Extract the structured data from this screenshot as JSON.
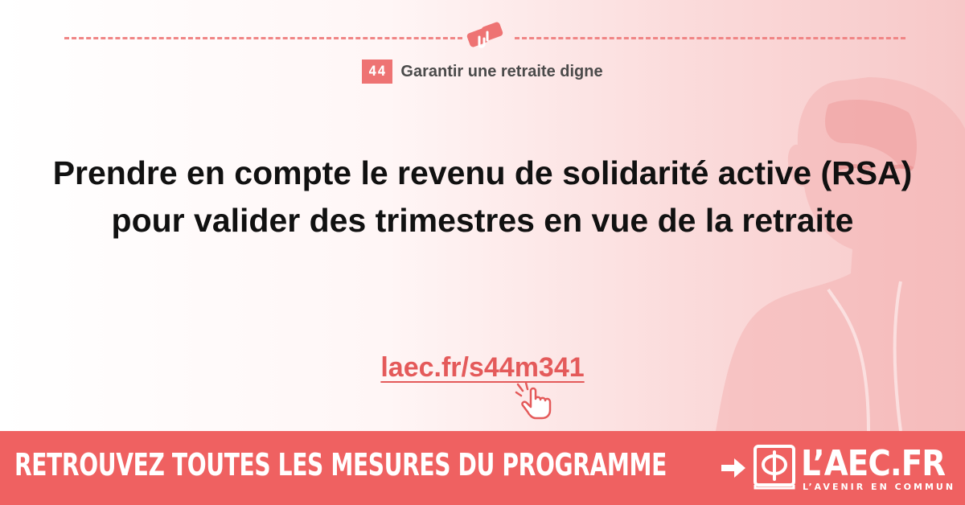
{
  "chapter": {
    "number": "44",
    "title": "Garantir une retraite digne"
  },
  "headline": "Prendre en compte le revenu de solidarité active (RSA) pour valider des trimestres en vue de la retraite",
  "link": {
    "text": "laec.fr/s44m341"
  },
  "banner": {
    "text": "RETROUVEZ TOUTES LES MESURES DU PROGRAMME",
    "logo_text": "L’AEC.FR",
    "logo_subtitle": "L’AVENIR EN COMMUN"
  },
  "colors": {
    "accent": "#ef6161",
    "link": "#e45a5a",
    "text": "#111111"
  },
  "icons": [
    "hands-icon",
    "pointer-hand-icon",
    "arrow-right-icon",
    "phi-book-logo-icon"
  ]
}
